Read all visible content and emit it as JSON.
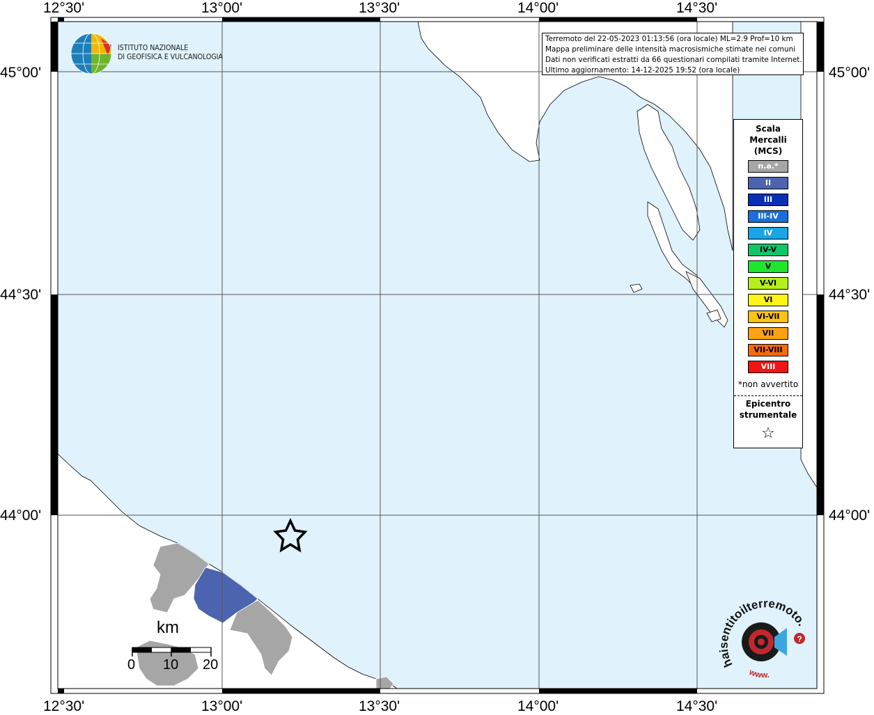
{
  "map": {
    "coordinates": {
      "lon_labels": [
        "12°30'",
        "13°00'",
        "13°30'",
        "14°00'",
        "14°30'"
      ],
      "lat_labels": [
        "45°00'",
        "44°30'",
        "44°00'"
      ]
    },
    "info_box": {
      "line1": "Terremoto del 22-05-2023 01:13:56 (ora locale) ML=2.9 Prof=10 km",
      "line2": "Mappa preliminare delle intensità macrosismiche stimate nei comuni",
      "line3": "Dati non verificati estratti da 66 questionari compilati tramite Internet.",
      "line4": "Ultimo aggiornamento: 14-12-2025 19:52 (ora locale)"
    },
    "logo": {
      "line1": "ISTITUTO NAZIONALE",
      "line2": "DI GEOFISICA E VULCANOLOGIA"
    },
    "legend": {
      "title1": "Scala",
      "title2": "Mercalli",
      "title3": "(MCS)",
      "classes": [
        {
          "label": "n.a.*",
          "color": "#a6a6a6",
          "text_color": "#ffffff"
        },
        {
          "label": "II",
          "color": "#4c64b0",
          "text_color": "#ffffff"
        },
        {
          "label": "III",
          "color": "#0a2fb5",
          "text_color": "#ffffff"
        },
        {
          "label": "III-IV",
          "color": "#1a6fdc",
          "text_color": "#ffffff"
        },
        {
          "label": "IV",
          "color": "#19a5e6",
          "text_color": "#ffffff"
        },
        {
          "label": "IV-V",
          "color": "#12c468",
          "text_color": "#000000"
        },
        {
          "label": "V",
          "color": "#1ee62d",
          "text_color": "#000000"
        },
        {
          "label": "V-VI",
          "color": "#b4f01c",
          "text_color": "#000000"
        },
        {
          "label": "VI",
          "color": "#fcf516",
          "text_color": "#000000"
        },
        {
          "label": "VI-VII",
          "color": "#fcc312",
          "text_color": "#000000"
        },
        {
          "label": "VII",
          "color": "#fca214",
          "text_color": "#000000"
        },
        {
          "label": "VII-VIII",
          "color": "#f76a0c",
          "text_color": "#000000"
        },
        {
          "label": "VIII",
          "color": "#f01414",
          "text_color": "#ffffff"
        }
      ],
      "note": "*non avvertito",
      "epicenter_title1": "Epicentro",
      "epicenter_title2": "strumentale",
      "epicenter_symbol": "☆"
    },
    "epicenter": {
      "lon": 13.2,
      "lat": 43.95
    },
    "scale_bar": {
      "unit": "km",
      "labels": [
        "0",
        "10",
        "20"
      ]
    },
    "haisentito": {
      "text": "haisentitoilterremoto.it",
      "prefix": "www."
    },
    "colors": {
      "sea": "#e0f2fc",
      "land": "#ffffff",
      "municipality_na": "#a6a6a6",
      "municipality_ii": "#4c64b0"
    }
  }
}
